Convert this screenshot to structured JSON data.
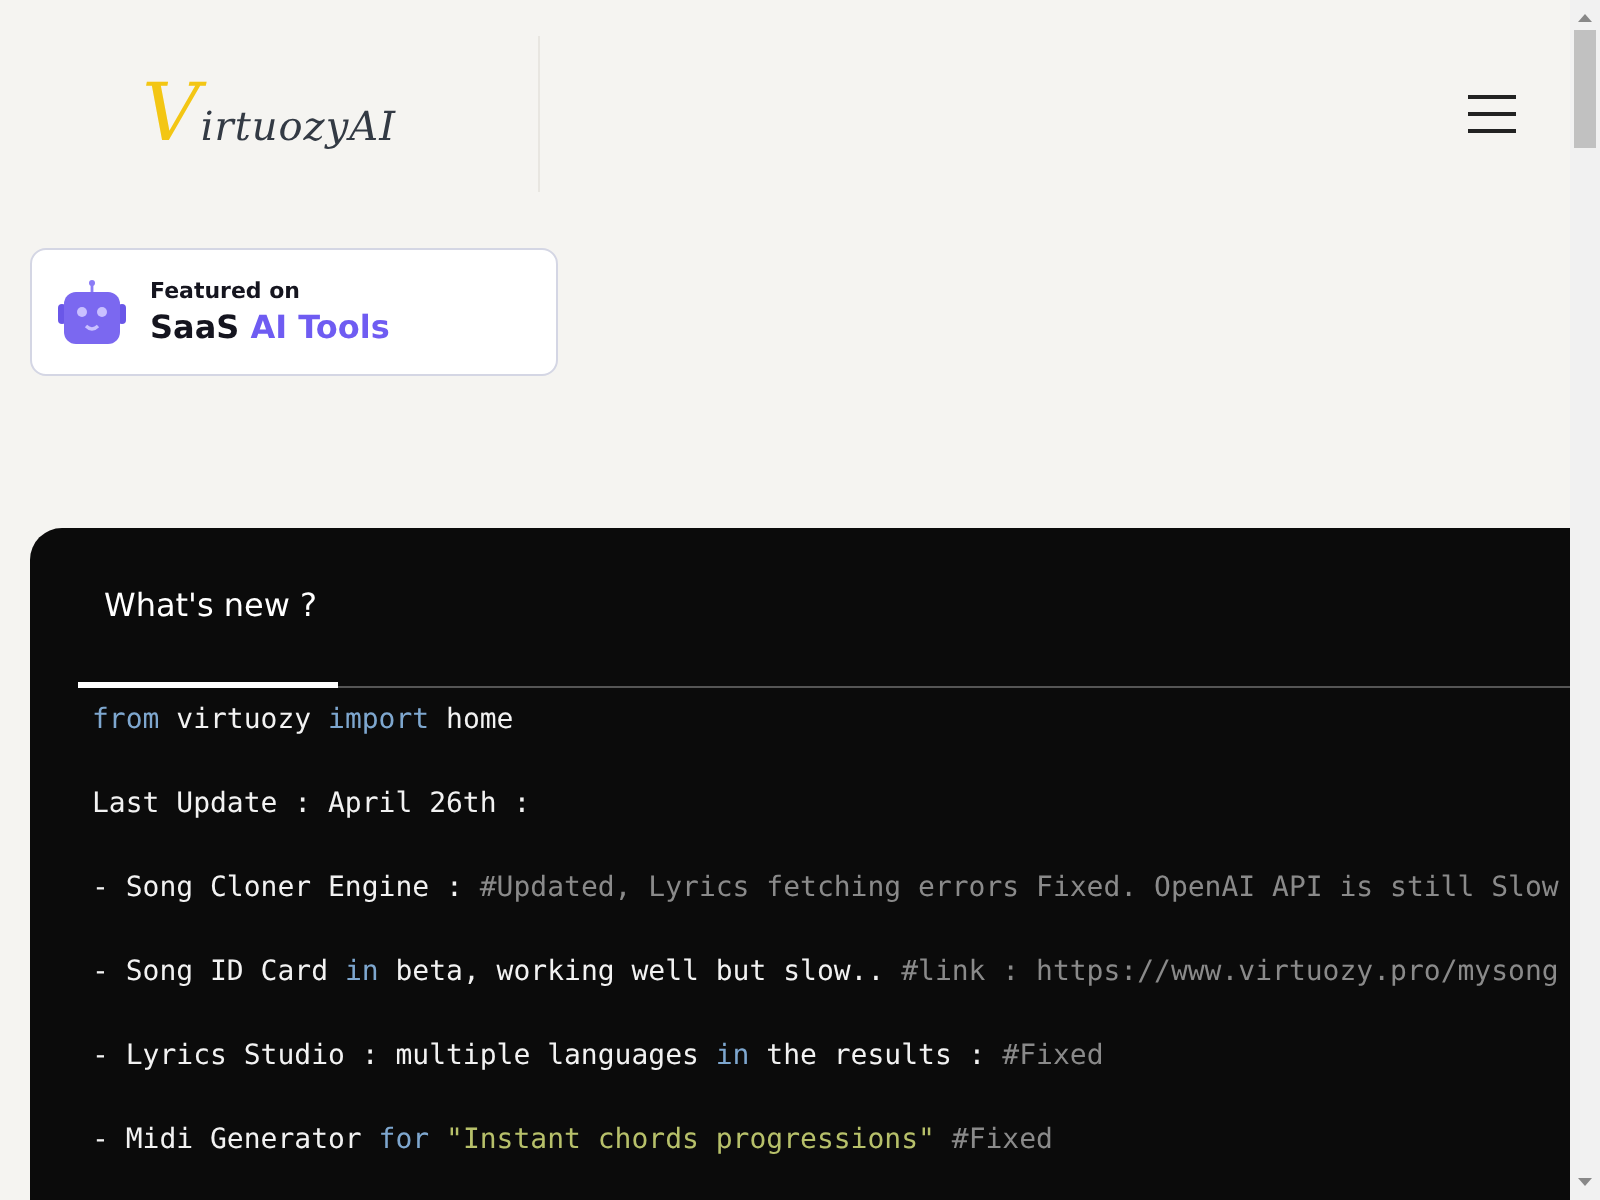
{
  "header": {
    "logo": {
      "initial": "V",
      "rest": "irtuozyAI"
    }
  },
  "badge": {
    "caption": "Featured on",
    "brand": "SaaS",
    "brand_accent": "AI Tools"
  },
  "panel": {
    "tabs": [
      {
        "label": "What's new ?",
        "selected": true
      }
    ],
    "code_lines": [
      [
        {
          "kind": "keyword",
          "text": "from"
        },
        {
          "kind": "plain",
          "text": " virtuozy "
        },
        {
          "kind": "keyword",
          "text": "import"
        },
        {
          "kind": "plain",
          "text": " home"
        }
      ],
      [
        {
          "kind": "plain",
          "text": "Last Update : April 26th :"
        }
      ],
      [
        {
          "kind": "plain",
          "text": "- Song Cloner Engine : "
        },
        {
          "kind": "comment",
          "text": "#Updated, Lyrics fetching errors Fixed. OpenAI API is still Slow"
        }
      ],
      [
        {
          "kind": "plain",
          "text": "- Song ID Card "
        },
        {
          "kind": "keyword",
          "text": "in"
        },
        {
          "kind": "plain",
          "text": " beta, working well but slow.. "
        },
        {
          "kind": "comment",
          "text": "#link : https://www.virtuozy.pro/mysong"
        }
      ],
      [
        {
          "kind": "plain",
          "text": "- Lyrics Studio : multiple languages "
        },
        {
          "kind": "keyword",
          "text": "in"
        },
        {
          "kind": "plain",
          "text": " the results : "
        },
        {
          "kind": "comment",
          "text": "#Fixed"
        }
      ],
      [
        {
          "kind": "plain",
          "text": "- Midi Generator "
        },
        {
          "kind": "keyword",
          "text": "for "
        },
        {
          "kind": "string",
          "text": "\"Instant chords progressions\" "
        },
        {
          "kind": "comment",
          "text": "#Fixed"
        }
      ]
    ]
  }
}
